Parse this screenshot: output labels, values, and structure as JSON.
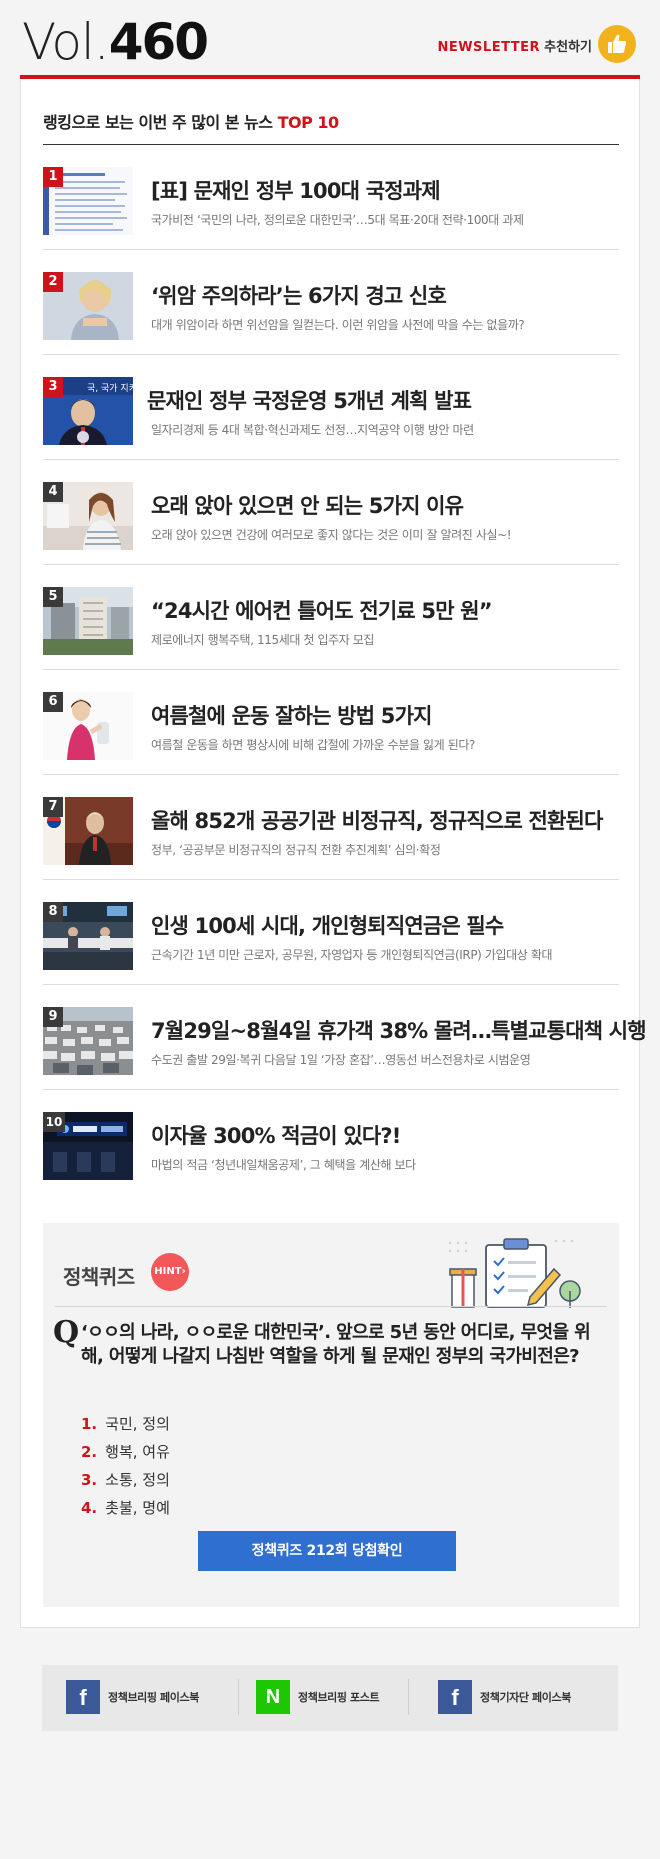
{
  "header": {
    "vol_prefix": "Vol.",
    "vol_number": "460",
    "newsletter_label": "NEWSLETTER",
    "recommend_label": "추천하기"
  },
  "ranking": {
    "title_prefix": "랭킹으로 보는 이번 주 많이 본 뉴스",
    "title_highlight": "TOP 10",
    "items": [
      {
        "rank": "1",
        "title": "[표] 문재인 정부 100대 국정과제",
        "subtitle": "국가비전 ‘국민의 나라, 정의로운 대한민국’…5대 목표·20대 전략·100대 과제"
      },
      {
        "rank": "2",
        "title": "‘위암 주의하라’는 6가지 경고 신호",
        "subtitle": "대개 위암이라 하면 위선암을 일컫는다. 이런 위암을 사전에 막을 수는 없을까?"
      },
      {
        "rank": "3",
        "title": "문재인 정부 국정운영 5개년 계획 발표",
        "subtitle": "일자리경제 등 4대 복합·혁신과제도 선정…지역공약 이행 방안 마련"
      },
      {
        "rank": "4",
        "title": "오래 앉아 있으면 안 되는 5가지 이유",
        "subtitle": "오래 앉아 있으면 건강에 여러모로 좋지 않다는 것은 이미 잘 알려진 사실~!"
      },
      {
        "rank": "5",
        "title": "“24시간 에어컨 틀어도 전기료 5만 원”",
        "subtitle": "제로에너지 행복주택, 115세대 첫 입주자 모집"
      },
      {
        "rank": "6",
        "title": "여름철에 운동 잘하는 방법 5가지",
        "subtitle": "여름철 운동을 하면 평상시에 비해 갑절에 가까운 수분을 잃게 된다?"
      },
      {
        "rank": "7",
        "title": "올해 852개 공공기관 비정규직, 정규직으로 전환된다",
        "subtitle": "정부, ‘공공부문 비정규직의 정규직 전환 추진계획’ 심의·확정"
      },
      {
        "rank": "8",
        "title": "인생 100세 시대, 개인형퇴직연금은 필수",
        "subtitle": "근속기간 1년 미만 근로자, 공무원, 자영업자 등 개인형퇴직연금(IRP) 가입대상 확대"
      },
      {
        "rank": "9",
        "title": "7월29일~8월4일 휴가객 38% 몰려…특별교통대책 시행",
        "subtitle": "수도권 출발 29일·복귀 다음달 1일 ‘가장 혼잡’…영동선 버스전용차로 시범운영"
      },
      {
        "rank": "10",
        "title": "이자율 300% 적금이 있다?!",
        "subtitle": "마법의 적금 ‘청년내일채움공제’, 그 혜택을 계산해 보다"
      }
    ]
  },
  "quiz": {
    "title": "정책퀴즈",
    "hint_label": "HINT",
    "q_mark": "Q",
    "question": "‘ㅇㅇ의 나라, ㅇㅇ로운 대한민국’. 앞으로 5년 동안 어디로, 무엇을 위해, 어떻게 나갈지 나침반 역할을 하게 될 문재인 정부의 국가비전은?",
    "options": [
      {
        "num": "1.",
        "text": "국민, 정의"
      },
      {
        "num": "2.",
        "text": "행복, 여유"
      },
      {
        "num": "3.",
        "text": "소통, 정의"
      },
      {
        "num": "4.",
        "text": "촛불, 명예"
      }
    ],
    "result_button": "정책퀴즈 212회 당첨확인"
  },
  "footer": {
    "links": [
      {
        "icon": "f",
        "label": "정책브리핑 페이스북"
      },
      {
        "icon": "N",
        "label": "정책브리핑 포스트"
      },
      {
        "icon": "f",
        "label": "정책기자단 페이스북"
      }
    ]
  },
  "colors": {
    "accent_red": "#d0121b",
    "button_blue": "#2f6fcf",
    "facebook_blue": "#3b5998",
    "naver_green": "#1ec800"
  }
}
